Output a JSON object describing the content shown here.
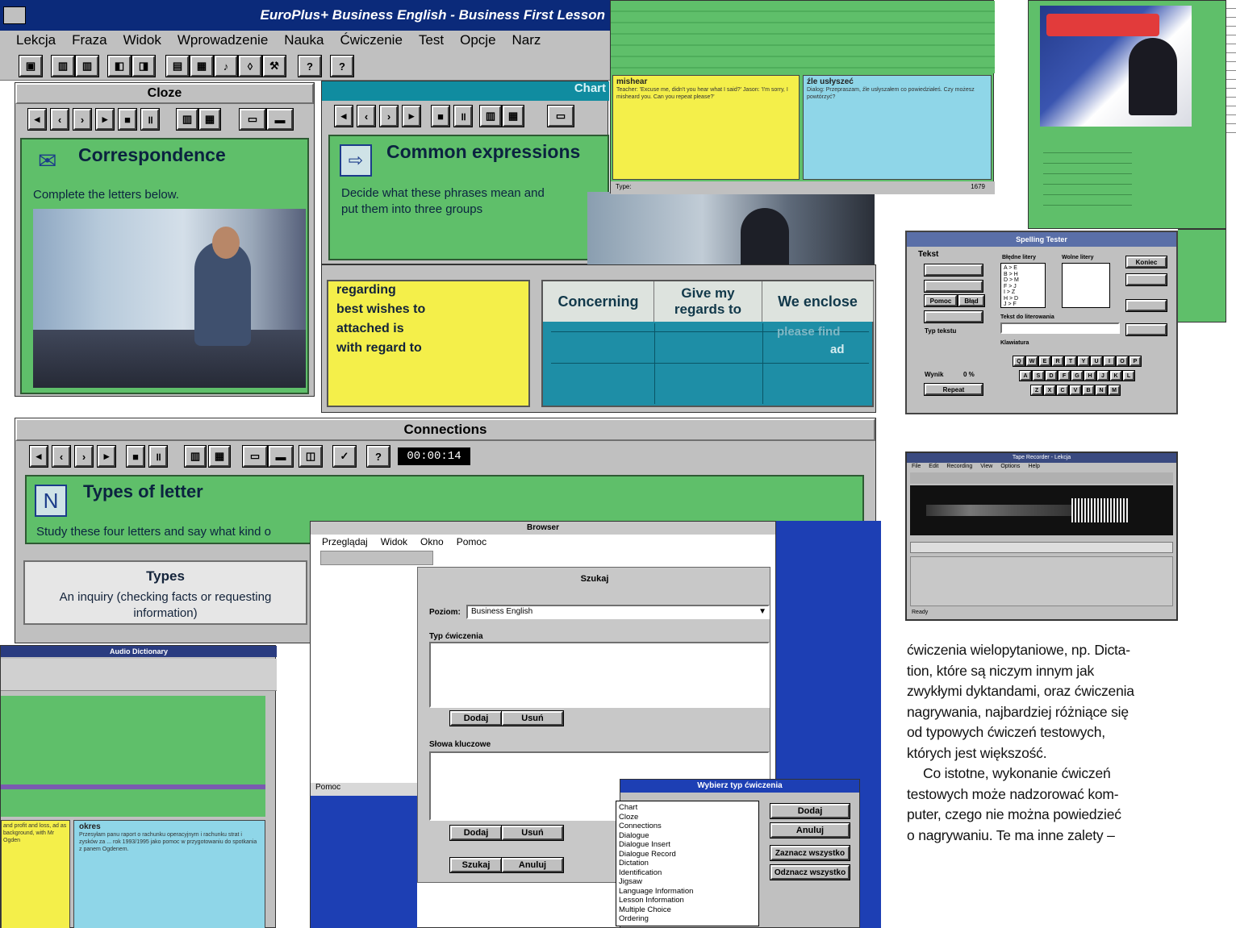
{
  "main_window": {
    "title": "EuroPlus+ Business English - Business First Lesson",
    "menu": [
      "Lekcja",
      "Fraza",
      "Widok",
      "Wprowadzenie",
      "Nauka",
      "Ćwiczenie",
      "Test",
      "Opcje",
      "Narz"
    ]
  },
  "cloze": {
    "title": "Cloze",
    "heading": "Correspondence",
    "instruction": "Complete the letters below."
  },
  "chart": {
    "title": "Chart",
    "heading": "Common expressions",
    "instruction_line1": "Decide what these phrases mean and",
    "instruction_line2": "put them into three groups",
    "phrases": [
      "regarding",
      "best wishes to",
      "attached is",
      "with regard to"
    ],
    "columns": [
      "Concerning",
      "Give my regards to",
      "We enclose"
    ],
    "cells": [
      "please find",
      "ad"
    ]
  },
  "connections": {
    "title": "Connections",
    "timer": "00:00:14",
    "heading": "Types of letter",
    "instruction": "Study these four letters and say what kind o",
    "table_header": "Types",
    "table_row": "An inquiry (checking facts or requesting information)"
  },
  "top_card": {
    "left_title": "mishear",
    "left_text": "Teacher: 'Excuse me, didn't you hear what I said?' Jason: 'I'm sorry, I misheard you. Can you repeat please?'",
    "right_title": "źle usłyszeć",
    "right_text": "Dialog: Przepraszam, źle usłyszałem co powiedziałeś. Czy możesz powtórzyć?",
    "footer_left": "Type:",
    "footer_right": "1679"
  },
  "audio_dictionary": {
    "title": "Audio Dictionary",
    "left_text": "and profit and loss, ad as background, with Mr Ogden",
    "right_title": "okres",
    "right_text": "Przesyłam panu raport o rachunku operacyjnym i rachunku strat i zysków za ... rok 1993/1995 jako pomoc w przygotowaniu do spotkania z panem Ogdenem."
  },
  "browser": {
    "title": "Browser",
    "menu": [
      "Przeglądaj",
      "Widok",
      "Okno",
      "Pomoc"
    ],
    "search_title": "Szukaj",
    "poziom_label": "Poziom:",
    "poziom_value": "Business English",
    "typ_label": "Typ ćwiczenia",
    "add": "Dodaj",
    "remove": "Usuń",
    "keywords_label": "Słowa kluczowe",
    "search_btn": "Szukaj",
    "cancel_btn": "Anuluj",
    "pomoc": "Pomoc"
  },
  "exercise_picker": {
    "title": "Wybierz typ ćwiczenia",
    "items": [
      "Chart",
      "Cloze",
      "Connections",
      "Dialogue",
      "Dialogue Insert",
      "Dialogue Record",
      "Dictation",
      "Identification",
      "Jigsaw",
      "Language Information",
      "Lesson Information",
      "Multiple Choice",
      "Ordering"
    ],
    "buttons": [
      "Dodaj",
      "Anuluj",
      "Zaznacz wszystko",
      "Odznacz wszystko"
    ]
  },
  "spelling": {
    "title": "Spelling Tester",
    "tekst": "Tekst",
    "wrong": "Błędne litery",
    "right_letters": "Wolne litery",
    "koniec": "Koniec",
    "pomoc": "Pomoc",
    "blad": "Błąd",
    "podtekst": "Tekst do literowania",
    "typ": "Typ tekstu",
    "wynik": "Wynik",
    "wynik_val": "0 %",
    "repeat": "Repeat",
    "klawiatura": "Klawiatura",
    "row1": [
      "Q",
      "W",
      "E",
      "R",
      "T",
      "Y",
      "U",
      "I",
      "O",
      "P"
    ],
    "row2": [
      "A",
      "S",
      "D",
      "F",
      "G",
      "H",
      "J",
      "K",
      "L"
    ],
    "row3": [
      "Z",
      "X",
      "C",
      "V",
      "B",
      "N",
      "M"
    ],
    "pairs": [
      "A > E",
      "B > H",
      "D > M",
      "F > J",
      "I > Z",
      "H > D",
      "J > F"
    ]
  },
  "recorder": {
    "title": "Tape Recorder - Lekcja",
    "menu": [
      "File",
      "Edit",
      "Recording",
      "View",
      "Options",
      "Help"
    ],
    "status": "Ready"
  },
  "article": {
    "lines": [
      "ćwiczenia wielopytaniowe, np. Dicta-",
      "tion, które są niczym innym jak",
      "zwykłymi dyktandami, oraz ćwiczenia",
      "nagrywania, najbardziej różniące się",
      "od typowych ćwiczeń testowych,",
      "których jest większość.",
      "Co istotne, wykonanie ćwiczeń",
      "testowych może nadzorować kom-",
      "puter, czego nie można powiedzieć",
      "o nagrywaniu. Te ma inne zalety –"
    ]
  }
}
